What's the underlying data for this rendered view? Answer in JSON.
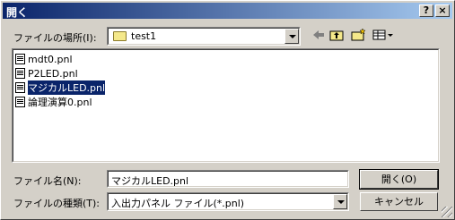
{
  "dialog": {
    "title": "開く"
  },
  "titlebar": {
    "help_label": "?",
    "close_label": "×"
  },
  "location": {
    "label": "ファイルの場所(I):",
    "value": "test1",
    "folder_icon": "folder-icon"
  },
  "toolbar": {
    "back_icon": "back-arrow-icon",
    "up_icon": "up-folder-icon",
    "newfolder_icon": "new-folder-icon",
    "view_icon": "view-menu-icon"
  },
  "files": [
    {
      "name": "mdt0.pnl",
      "selected": false
    },
    {
      "name": "P2LED.pnl",
      "selected": false
    },
    {
      "name": "マジカルLED.pnl",
      "selected": true
    },
    {
      "name": "論理演算0.pnl",
      "selected": false
    }
  ],
  "filename": {
    "label": "ファイル名(N):",
    "value": "マジカルLED.pnl"
  },
  "filetype": {
    "label": "ファイルの種類(T):",
    "value": "入出力パネル ファイル(*.pnl)"
  },
  "buttons": {
    "open_label": "開く(O)",
    "cancel_label": "キャンセル"
  }
}
